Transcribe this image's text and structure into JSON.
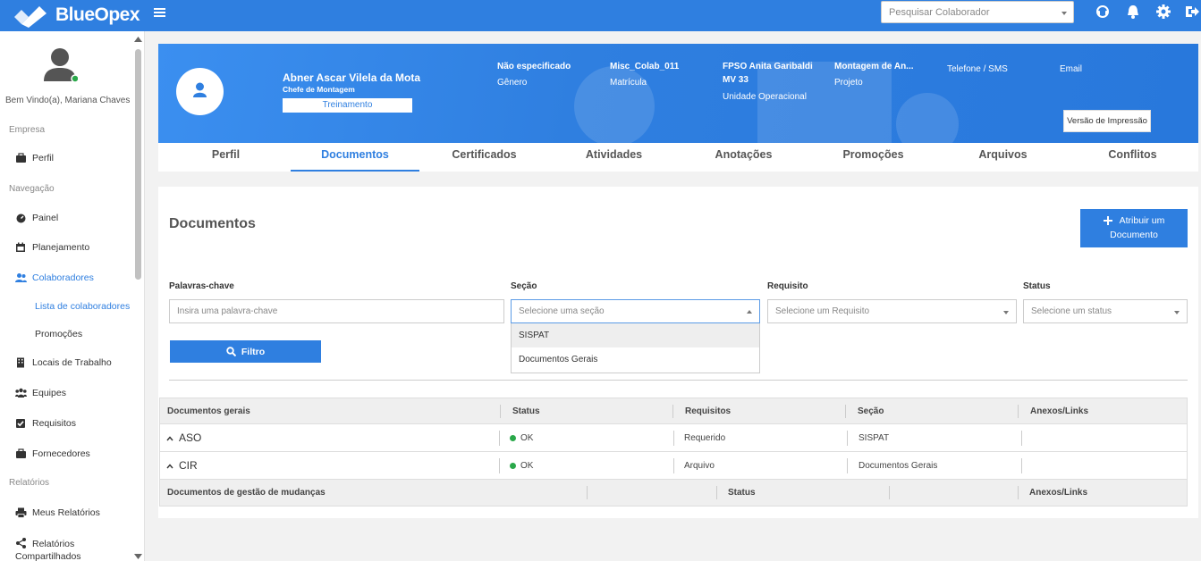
{
  "app": {
    "name": "BlueOpex"
  },
  "topbar": {
    "search_placeholder": "Pesquisar Colaborador",
    "icons": [
      "menu-icon",
      "headset-icon",
      "bell-icon",
      "gear-icon",
      "logout-icon"
    ]
  },
  "sidebar": {
    "welcome": "Bem Vindo(a), Mariana Chaves",
    "sections": {
      "empresa": "Empresa",
      "navegacao": "Navegação",
      "relatorios": "Relatórios"
    },
    "items": {
      "perfil": "Perfil",
      "painel": "Painel",
      "planejamento": "Planejamento",
      "colaboradores": "Colaboradores",
      "lista": "Lista de colaboradores",
      "promocoes": "Promoções",
      "locais": "Locais de Trabalho",
      "equipes": "Equipes",
      "requisitos": "Requisitos",
      "fornecedores": "Fornecedores",
      "meus_relatorios": "Meus Relatórios",
      "relatorios_comp_1": "Relatórios",
      "relatorios_comp_2": "Compartilhados"
    },
    "accent": "#2f7fe0"
  },
  "profile": {
    "name": "Abner Ascar Vilela da Mota",
    "role": "Chefe de Montagem",
    "badge": "Treinamento",
    "genero_value": "Não especificado",
    "genero_label": "Gênero",
    "matricula_value": "Misc_Colab_011",
    "matricula_label": "Matrícula",
    "unidade_value_1": "FPSO Anita Garibaldi",
    "unidade_value_2": "MV 33",
    "unidade_label": "Unidade Operacional",
    "projeto_value": "Montagem de An...",
    "projeto_label": "Projeto",
    "telefone_label": "Telefone / SMS",
    "email_label": "Email",
    "print_button": "Versão de Impressão"
  },
  "tabs": [
    "Perfil",
    "Documentos",
    "Certificados",
    "Atividades",
    "Anotações",
    "Promoções",
    "Arquivos",
    "Conflitos"
  ],
  "active_tab": "Documentos",
  "documents": {
    "title": "Documentos",
    "add_button_line1": "Atribuir um",
    "add_button_line2": "Documento",
    "filters": {
      "keywords_label": "Palavras-chave",
      "keywords_placeholder": "Insira uma palavra-chave",
      "secao_label": "Seção",
      "secao_placeholder": "Selecione uma seção",
      "requisito_label": "Requisito",
      "requisito_placeholder": "Selecione um Requisito",
      "status_label": "Status",
      "status_placeholder": "Selecione um status",
      "secao_options": [
        "SISPAT",
        "Documentos Gerais"
      ],
      "filter_button": "Filtro"
    },
    "table1": {
      "headers": [
        "Documentos gerais",
        "Status",
        "Requisitos",
        "Seção",
        "Anexos/Links"
      ],
      "rows": [
        {
          "name": "ASO",
          "status": "OK",
          "requisito": "Requerido",
          "secao": "SISPAT",
          "anexos": ""
        },
        {
          "name": "CIR",
          "status": "OK",
          "requisito": "Arquivo",
          "secao": "Documentos Gerais",
          "anexos": ""
        }
      ],
      "status_color": "#2aa84a"
    },
    "table2": {
      "headers": [
        "Documentos de gestão de mudanças",
        "Status",
        "Anexos/Links"
      ]
    }
  }
}
